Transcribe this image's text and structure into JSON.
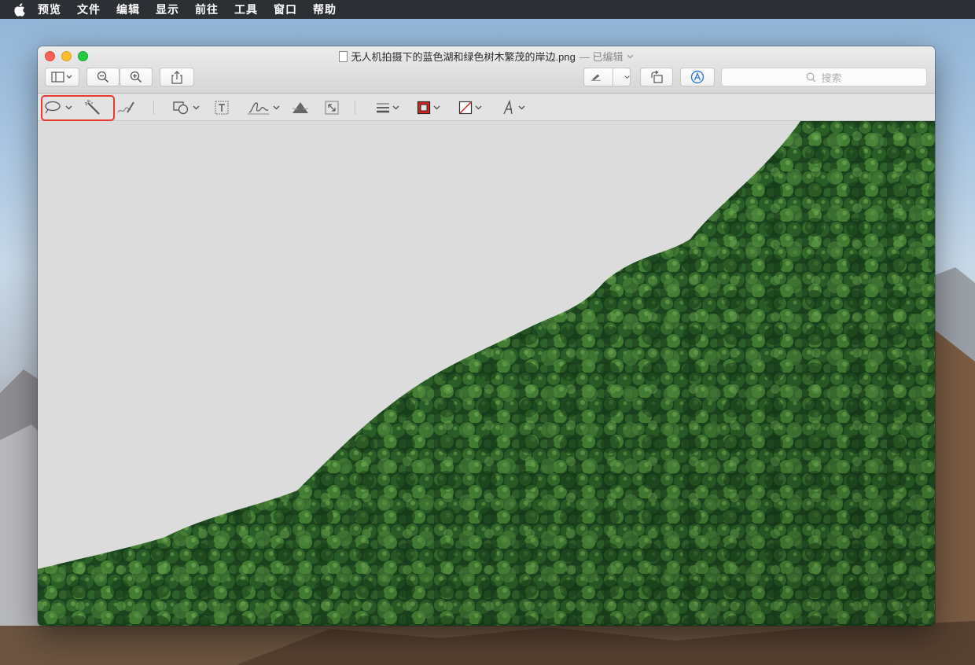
{
  "menubar": {
    "apple_icon": "apple-icon",
    "items": [
      "预览",
      "文件",
      "编辑",
      "显示",
      "前往",
      "工具",
      "窗口",
      "帮助"
    ]
  },
  "window": {
    "filename": "无人机拍摄下的蓝色湖和绿色树木繁茂的岸边.png",
    "edited_label": "— 已编辑",
    "search_placeholder": "搜索"
  },
  "colors": {
    "highlight": "#e8392b",
    "forest_dark": "#1f4d22",
    "forest_light": "#4c8f3a",
    "canvas_bg": "#dcdcdc"
  }
}
